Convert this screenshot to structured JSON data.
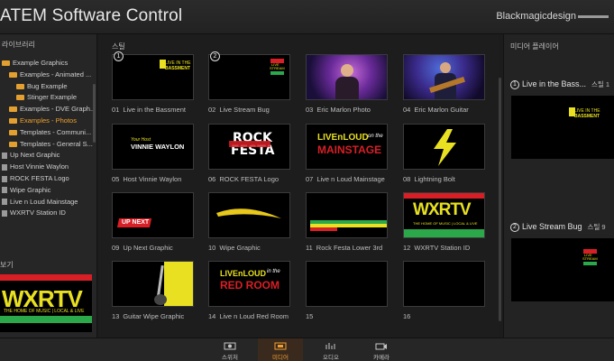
{
  "header": {
    "title": "ATEM Software Control",
    "brand": "Blackmagicdesign"
  },
  "library": {
    "heading": "라이브러리",
    "items": [
      {
        "label": "Example Graphics",
        "kind": "folder",
        "level": 0,
        "selected": false
      },
      {
        "label": "Examples - Animated ...",
        "kind": "folder",
        "level": 1,
        "selected": false
      },
      {
        "label": "Bug Example",
        "kind": "folder",
        "level": 2,
        "selected": false
      },
      {
        "label": "Stinger Example",
        "kind": "folder",
        "level": 2,
        "selected": false
      },
      {
        "label": "Examples - DVE Graph...",
        "kind": "folder",
        "level": 1,
        "selected": false
      },
      {
        "label": "Examples - Photos",
        "kind": "folder",
        "level": 1,
        "selected": true
      },
      {
        "label": "Templates - Communi...",
        "kind": "folder",
        "level": 1,
        "selected": false
      },
      {
        "label": "Templates - General S...",
        "kind": "folder",
        "level": 1,
        "selected": false
      },
      {
        "label": "Up Next Graphic",
        "kind": "file",
        "level": 0,
        "selected": false
      },
      {
        "label": "Host Vinnie Waylon",
        "kind": "file",
        "level": 0,
        "selected": false
      },
      {
        "label": "ROCK FESTA Logo",
        "kind": "file",
        "level": 0,
        "selected": false
      },
      {
        "label": "Wipe Graphic",
        "kind": "file",
        "level": 0,
        "selected": false
      },
      {
        "label": "Live n Loud Mainstage",
        "kind": "file",
        "level": 0,
        "selected": false
      },
      {
        "label": "WXRTV Station ID",
        "kind": "file",
        "level": 0,
        "selected": false
      }
    ],
    "preview_heading": "보기",
    "preview": {
      "logo": "WXRTV",
      "tagline": "THE HOME OF MUSIC | LOCAL & LIVE"
    }
  },
  "stills": {
    "heading": "스틸",
    "items": [
      {
        "num": "01",
        "label": "Live in the Bassment",
        "slot": "1",
        "art": "bassment"
      },
      {
        "num": "02",
        "label": "Live Stream Bug",
        "slot": "2",
        "art": "bug"
      },
      {
        "num": "03",
        "label": "Eric Marlon Photo",
        "slot": "",
        "art": "photo1"
      },
      {
        "num": "04",
        "label": "Eric Marlon Guitar",
        "slot": "",
        "art": "photo2"
      },
      {
        "num": "05",
        "label": "Host Vinnie Waylon",
        "slot": "",
        "art": "host"
      },
      {
        "num": "06",
        "label": "ROCK FESTA Logo",
        "slot": "",
        "art": "rockfesta"
      },
      {
        "num": "07",
        "label": "Live n Loud Mainstage",
        "slot": "",
        "art": "mainstage"
      },
      {
        "num": "08",
        "label": "Lightning Bolt",
        "slot": "",
        "art": "bolt"
      },
      {
        "num": "09",
        "label": "Up Next Graphic",
        "slot": "",
        "art": "upnext"
      },
      {
        "num": "10",
        "label": "Wipe Graphic",
        "slot": "",
        "art": "wipe"
      },
      {
        "num": "11",
        "label": "Rock Festa Lower 3rd",
        "slot": "",
        "art": "lower3rd"
      },
      {
        "num": "12",
        "label": "WXRTV Station ID",
        "slot": "",
        "art": "wxrtv"
      },
      {
        "num": "13",
        "label": "Guitar Wipe Graphic",
        "slot": "",
        "art": "guitarwipe"
      },
      {
        "num": "14",
        "label": "Live n Loud Red Room",
        "slot": "",
        "art": "redroom"
      },
      {
        "num": "15",
        "label": "",
        "slot": "",
        "art": "empty"
      },
      {
        "num": "16",
        "label": "",
        "slot": "",
        "art": "empty"
      }
    ]
  },
  "thumb_text": {
    "bassment_a": "LIVE IN THE",
    "bassment_b": "BASSMENT",
    "bug_a": "LIVE",
    "bug_b": "STREAM",
    "host_a": "Your Host",
    "host_b": "VINNIE WAYLON",
    "rock": "ROCK",
    "festa": "FESTA",
    "mainstage_a": "LIVEnLOUD",
    "mainstage_b": "on the",
    "mainstage_c": "MAINSTAGE",
    "upnext": "UP NEXT",
    "wxrtv": "WXRTV",
    "wxrtv_tag": "THE HOME OF MUSIC | LOCAL & LIVE",
    "redroom_a": "LIVEnLOUD",
    "redroom_b": "in the",
    "redroom_c": "RED ROOM"
  },
  "media_player": {
    "heading": "미디어 플레이어",
    "players": [
      {
        "slot": "1",
        "title": "Live in the Bass...",
        "still": "스틸 1",
        "art": "bassment"
      },
      {
        "slot": "2",
        "title": "Live Stream Bug",
        "still": "스틸 9",
        "art": "bug"
      }
    ]
  },
  "bottom_tabs": [
    {
      "label": "스위처",
      "icon": "switcher-icon",
      "active": false
    },
    {
      "label": "미디어",
      "icon": "media-icon",
      "active": true
    },
    {
      "label": "오디오",
      "icon": "audio-icon",
      "active": false
    },
    {
      "label": "카메라",
      "icon": "camera-icon",
      "active": false
    }
  ],
  "colors": {
    "accent": "#f0a030",
    "brand_yellow": "#e8e020",
    "red": "#d81f26",
    "green": "#2aa84a"
  }
}
